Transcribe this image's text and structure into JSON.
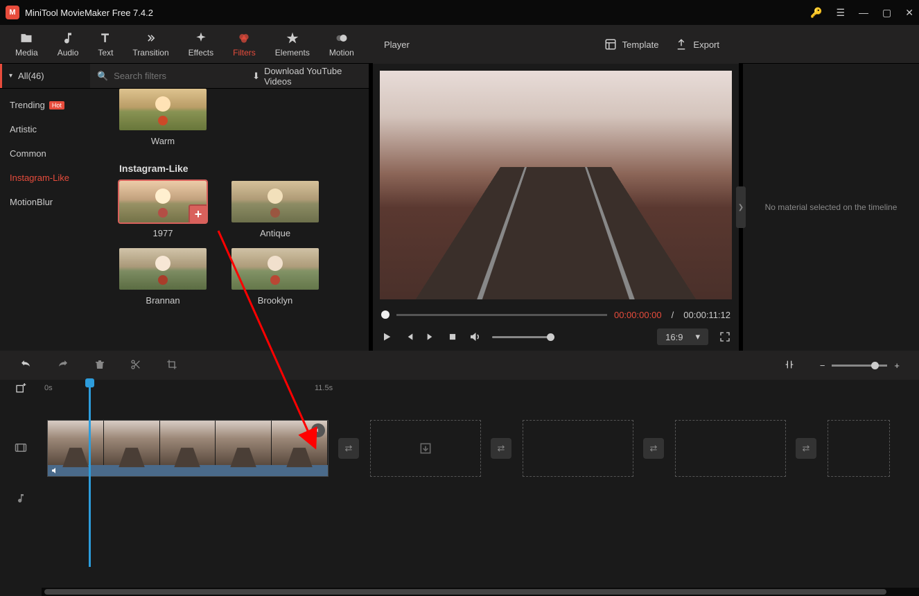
{
  "titlebar": {
    "app_name": "MiniTool MovieMaker Free 7.4.2"
  },
  "toolbar": {
    "tabs": [
      {
        "label": "Media"
      },
      {
        "label": "Audio"
      },
      {
        "label": "Text"
      },
      {
        "label": "Transition"
      },
      {
        "label": "Effects"
      },
      {
        "label": "Filters"
      },
      {
        "label": "Elements"
      },
      {
        "label": "Motion"
      }
    ]
  },
  "filters_panel": {
    "all_label": "All(46)",
    "search_placeholder": "Search filters",
    "download_label": "Download YouTube Videos",
    "categories": [
      {
        "label": "Trending",
        "hot": true
      },
      {
        "label": "Artistic"
      },
      {
        "label": "Common"
      },
      {
        "label": "Instagram-Like",
        "active": true
      },
      {
        "label": "MotionBlur"
      }
    ],
    "warm_label": "Warm",
    "section_title": "Instagram-Like",
    "items": [
      {
        "label": "1977",
        "selected": true
      },
      {
        "label": "Antique"
      },
      {
        "label": "Brannan"
      },
      {
        "label": "Brooklyn"
      }
    ]
  },
  "player": {
    "title": "Player",
    "template_label": "Template",
    "export_label": "Export",
    "current_time": "00:00:00:00",
    "total_time": "00:00:11:12",
    "ratio": "16:9"
  },
  "right_panel": {
    "empty_msg": "No material selected on the timeline"
  },
  "timeline": {
    "ruler": {
      "start": "0s",
      "mid": "11.5s"
    }
  }
}
